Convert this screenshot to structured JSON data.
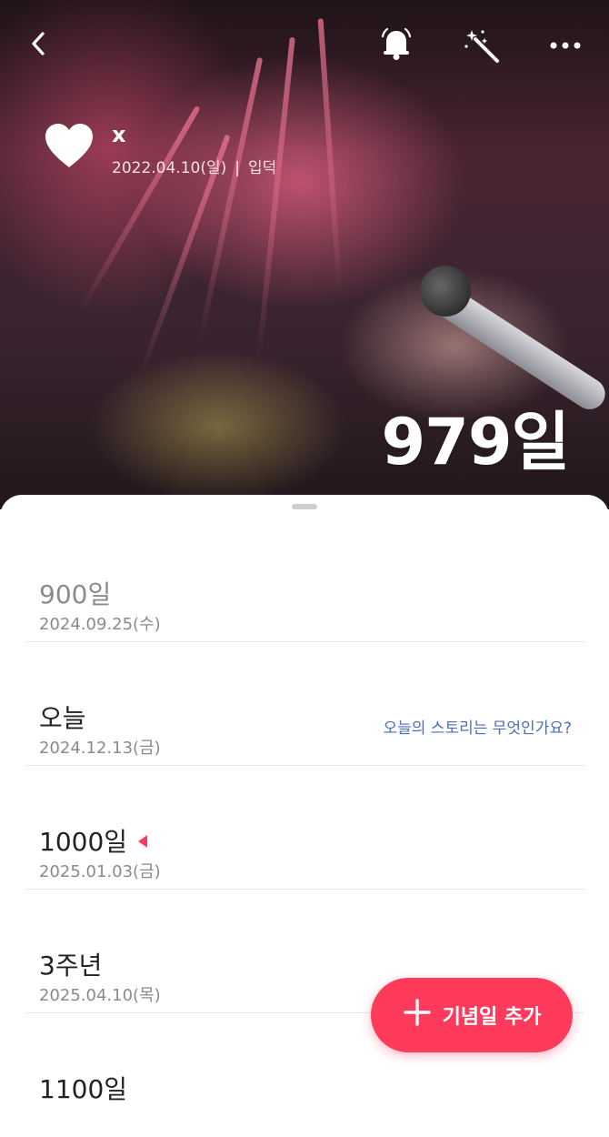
{
  "header": {
    "back_icon": "chevron-left-icon",
    "bell_icon": "bell-icon",
    "wand_icon": "magic-wand-icon",
    "more_icon": "more-horizontal-icon"
  },
  "profile": {
    "icon": "heart-icon",
    "name": "x",
    "start_date": "2022.04.10(일)",
    "separator": "|",
    "tag": "입덕"
  },
  "counter": {
    "value": "979일"
  },
  "list": {
    "items": [
      {
        "title": "900일",
        "date": "2024.09.25(수)",
        "state": "past"
      },
      {
        "title": "오늘",
        "date": "2024.12.13(금)",
        "link": "오늘의 스토리는 무엇인가요?",
        "state": "today"
      },
      {
        "title": "1000일",
        "date": "2025.01.03(금)",
        "state": "next"
      },
      {
        "title": "3주년",
        "date": "2025.04.10(목)",
        "state": "future"
      },
      {
        "title": "1100일",
        "date": "",
        "state": "future"
      }
    ]
  },
  "fab": {
    "icon": "plus-icon",
    "label": "기념일 추가"
  },
  "colors": {
    "accent": "#ff3b5c",
    "link": "#4a6fb8",
    "muted_text": "#8a8a8f"
  }
}
